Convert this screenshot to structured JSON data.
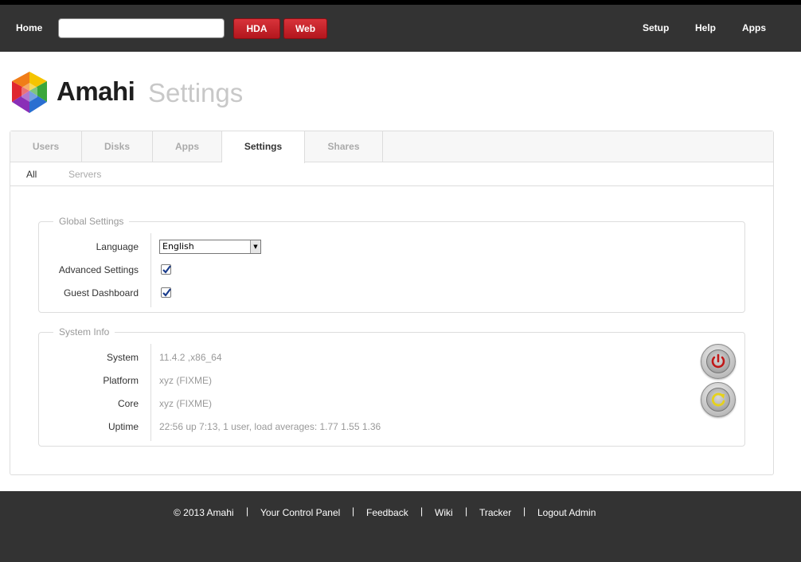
{
  "topbar": {
    "home_label": "Home",
    "search_value": "",
    "search_placeholder": "",
    "hda_button": "HDA",
    "web_button": "Web",
    "nav": {
      "setup": "Setup",
      "help": "Help",
      "apps": "Apps"
    }
  },
  "brand": {
    "logo_text": "Amahi",
    "page_title": "Settings"
  },
  "tabs": [
    {
      "label": "Users"
    },
    {
      "label": "Disks"
    },
    {
      "label": "Apps"
    },
    {
      "label": "Settings",
      "active": true
    },
    {
      "label": "Shares"
    }
  ],
  "subtabs": [
    {
      "label": "All",
      "active": true
    },
    {
      "label": "Servers"
    }
  ],
  "global_settings": {
    "legend": "Global Settings",
    "language_label": "Language",
    "language_value": "English",
    "advanced_label": "Advanced Settings",
    "advanced_checked": true,
    "guest_label": "Guest Dashboard",
    "guest_checked": true
  },
  "system_info": {
    "legend": "System Info",
    "rows": [
      {
        "label": "System",
        "value": "11.4.2 ,x86_64"
      },
      {
        "label": "Platform",
        "value": "xyz (FIXME)"
      },
      {
        "label": "Core",
        "value": "xyz (FIXME)"
      },
      {
        "label": "Uptime",
        "value": "22:56 up 7:13, 1 user, load averages: 1.77 1.55 1.36"
      }
    ],
    "power_icon": "power-icon",
    "reboot_icon": "reboot-icon"
  },
  "footer": {
    "copyright": "© 2013 Amahi",
    "links": [
      "Your Control Panel",
      "Feedback",
      "Wiki",
      "Tracker",
      "Logout Admin"
    ],
    "separator": "|"
  },
  "colors": {
    "topbar_bg": "#333333",
    "accent_red": "#c4242b",
    "checkbox_check": "#1a3c8c"
  }
}
